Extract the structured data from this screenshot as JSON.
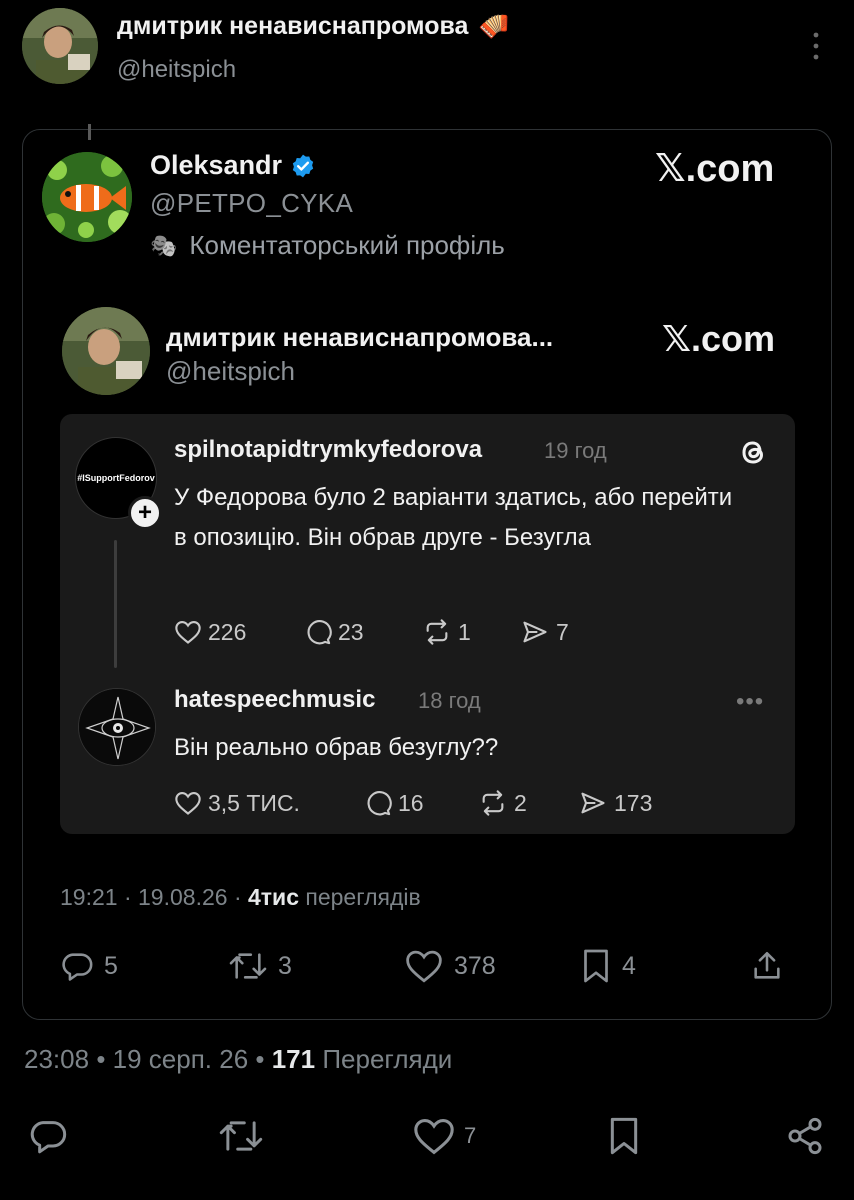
{
  "post": {
    "author_name": "дмитрик ненависнапромова",
    "author_emoji": "🪗",
    "author_handle": "@heitspich"
  },
  "quoted_x_post": {
    "author_name": "Oleksandr",
    "author_handle": "@PETPO_CYKA",
    "bio_icon": "🎭",
    "bio": "Коментаторський профіль",
    "brand": "𝕏.com",
    "inner_post": {
      "author_name": "дмитрик ненависнапромова...",
      "author_handle": "@heitspich",
      "brand": "𝕏.com"
    },
    "threads_card": {
      "post": {
        "avatar_text": "#ISupportFedorov",
        "username": "spilnotapidtrymkyfedorova",
        "time": "19 год",
        "text": "У Федорова було 2 варіанти здатись, або перейти в опозицію. Він обрав друге - Безугла",
        "likes": "226",
        "replies": "23",
        "reposts": "1",
        "shares": "7"
      },
      "reply": {
        "username": "hatespeechmusic",
        "time": "18 год",
        "more": "•••",
        "text": "Він реально обрав безуглу??",
        "likes": "3,5 ТИС.",
        "replies": "16",
        "reposts": "2",
        "shares": "173"
      }
    },
    "meta": {
      "time": "19:21",
      "date": "19.08.26",
      "views_count": "4тис",
      "views_label": "переглядів"
    },
    "actions": {
      "replies": "5",
      "reposts": "3",
      "likes": "378",
      "bookmarks": "4"
    }
  },
  "meta": {
    "time": "23:08",
    "date": "19 серп. 26",
    "views_count": "171",
    "views_label": "Перегляди"
  },
  "actions": {
    "likes": "7"
  },
  "colors": {
    "background": "#000000",
    "card_border": "#2f3336",
    "threads_card_bg": "#1a1a1a",
    "verified_badge": "#1d9bf0",
    "muted_text": "#7d8489"
  }
}
